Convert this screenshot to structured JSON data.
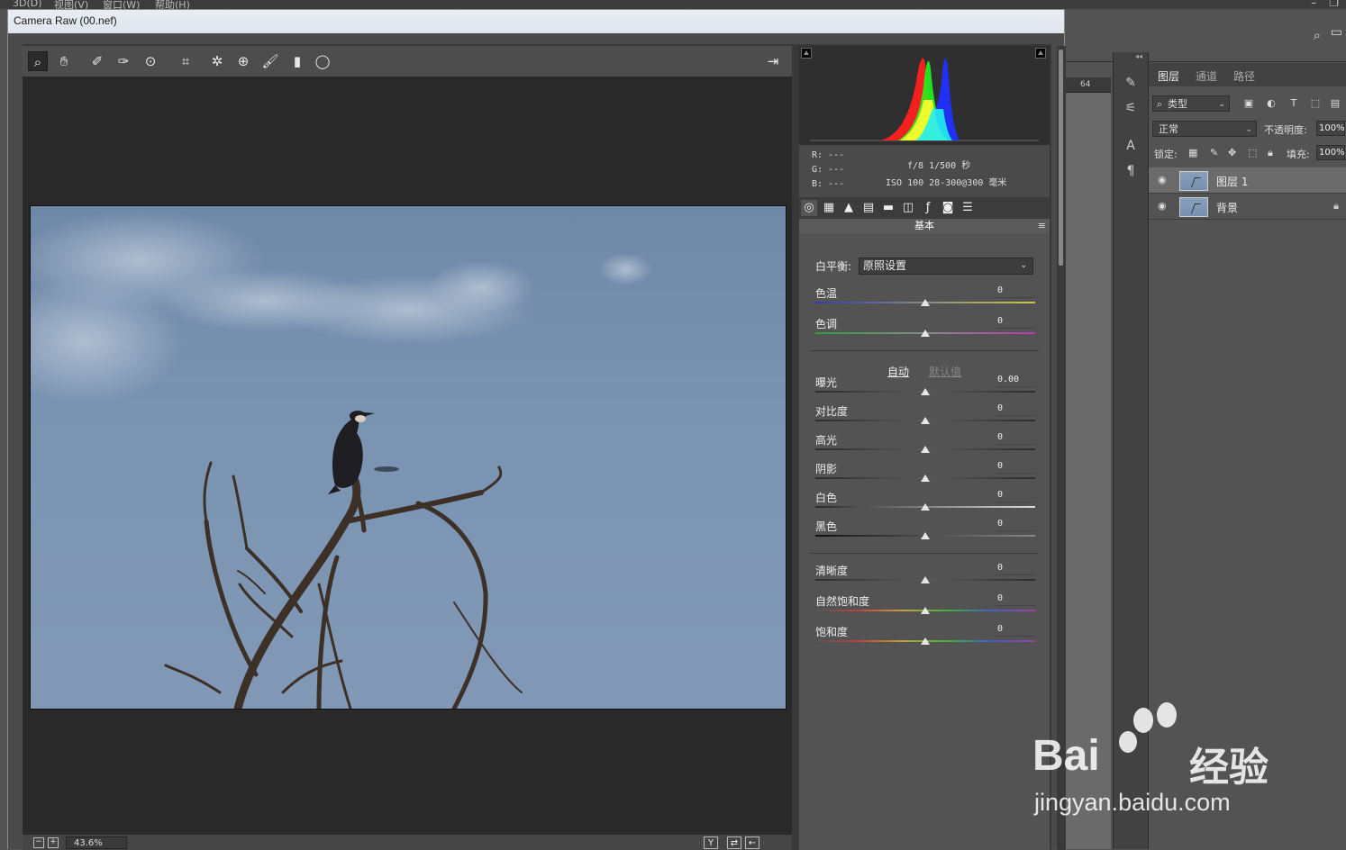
{
  "ps": {
    "menu": [
      "3D(D)",
      "视图(V)",
      "窗口(W)",
      "帮助(H)"
    ],
    "ruler_mark": "64",
    "layers_panel": {
      "tabs": [
        "图层",
        "通道",
        "路径"
      ],
      "filter_kind": "类型",
      "blend_mode": "正常",
      "opacity_label": "不透明度:",
      "opacity_value": "100%",
      "lock_label": "锁定:",
      "fill_label": "填充:",
      "fill_value": "100%",
      "layers": [
        {
          "name": "图层 1",
          "selected": true
        },
        {
          "name": "背景",
          "locked": true
        }
      ]
    }
  },
  "camera_raw": {
    "title": "Camera Raw (00.nef)",
    "histogram": {
      "r": "R:  ---",
      "g": "G:  ---",
      "b": "B:  ---"
    },
    "exif": {
      "line1": "f/8   1/500 秒",
      "line2": "ISO 100   28-300@300 毫米"
    },
    "section_title": "基本",
    "white_balance": {
      "label": "白平衡:",
      "value": "原照设置"
    },
    "auto_label": "自动",
    "default_label": "默认值",
    "sliders": {
      "temperature": {
        "label": "色温",
        "value": "0",
        "position": 0.5
      },
      "tint": {
        "label": "色调",
        "value": "0",
        "position": 0.5
      },
      "exposure": {
        "label": "曝光",
        "value": "0.00",
        "position": 0.5
      },
      "contrast": {
        "label": "对比度",
        "value": "0",
        "position": 0.5
      },
      "highlights": {
        "label": "高光",
        "value": "0",
        "position": 0.5
      },
      "shadows": {
        "label": "阴影",
        "value": "0",
        "position": 0.5
      },
      "whites": {
        "label": "白色",
        "value": "0",
        "position": 0.5
      },
      "blacks": {
        "label": "黑色",
        "value": "0",
        "position": 0.5
      },
      "clarity": {
        "label": "清晰度",
        "value": "0",
        "position": 0.5
      },
      "vibrance": {
        "label": "自然饱和度",
        "value": "0",
        "position": 0.5
      },
      "saturation": {
        "label": "饱和度",
        "value": "0",
        "position": 0.5
      }
    },
    "zoom": "43.6%",
    "view_buttons": [
      "Y",
      "⇄",
      "←"
    ]
  },
  "watermark": {
    "brand": "Bai",
    "brand_cn": "经验",
    "url": "jingyan.baidu.com"
  },
  "colors": {
    "sky": "#7a93b2",
    "panel": "#535353",
    "title_bar": "#e3e9f1"
  }
}
